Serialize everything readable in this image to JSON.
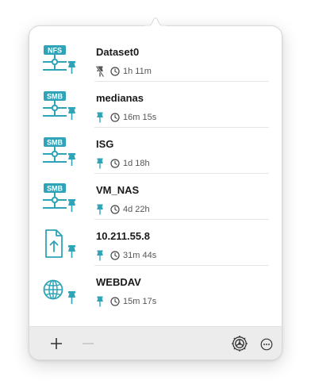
{
  "colors": {
    "accent": "#2fa4b8",
    "badge_text": "#ffffff",
    "secondary": "#555555"
  },
  "mounts": [
    {
      "name": "Dataset0",
      "protocol": "NFS",
      "icon": "nfs-share-icon",
      "pin": "pin-slash-icon",
      "duration": "1h 11m"
    },
    {
      "name": "medianas",
      "protocol": "SMB",
      "icon": "smb-share-icon",
      "pin": "pin-icon",
      "duration": "16m 15s"
    },
    {
      "name": "ISG",
      "protocol": "SMB",
      "icon": "smb-share-icon",
      "pin": "pin-icon",
      "duration": "1d 18h"
    },
    {
      "name": "VM_NAS",
      "protocol": "SMB",
      "icon": "smb-share-icon",
      "pin": "pin-icon",
      "duration": "4d 22h"
    },
    {
      "name": "10.211.55.8",
      "protocol": "",
      "icon": "file-share-icon",
      "pin": "pin-icon",
      "duration": "31m 44s"
    },
    {
      "name": "WEBDAV",
      "protocol": "",
      "icon": "globe-icon",
      "pin": "pin-icon",
      "duration": "15m 17s"
    }
  ],
  "footer": {
    "add_icon": "plus-icon",
    "remove_icon": "minus-icon",
    "settings_icon": "gear-icon",
    "more_icon": "ellipsis-icon"
  }
}
